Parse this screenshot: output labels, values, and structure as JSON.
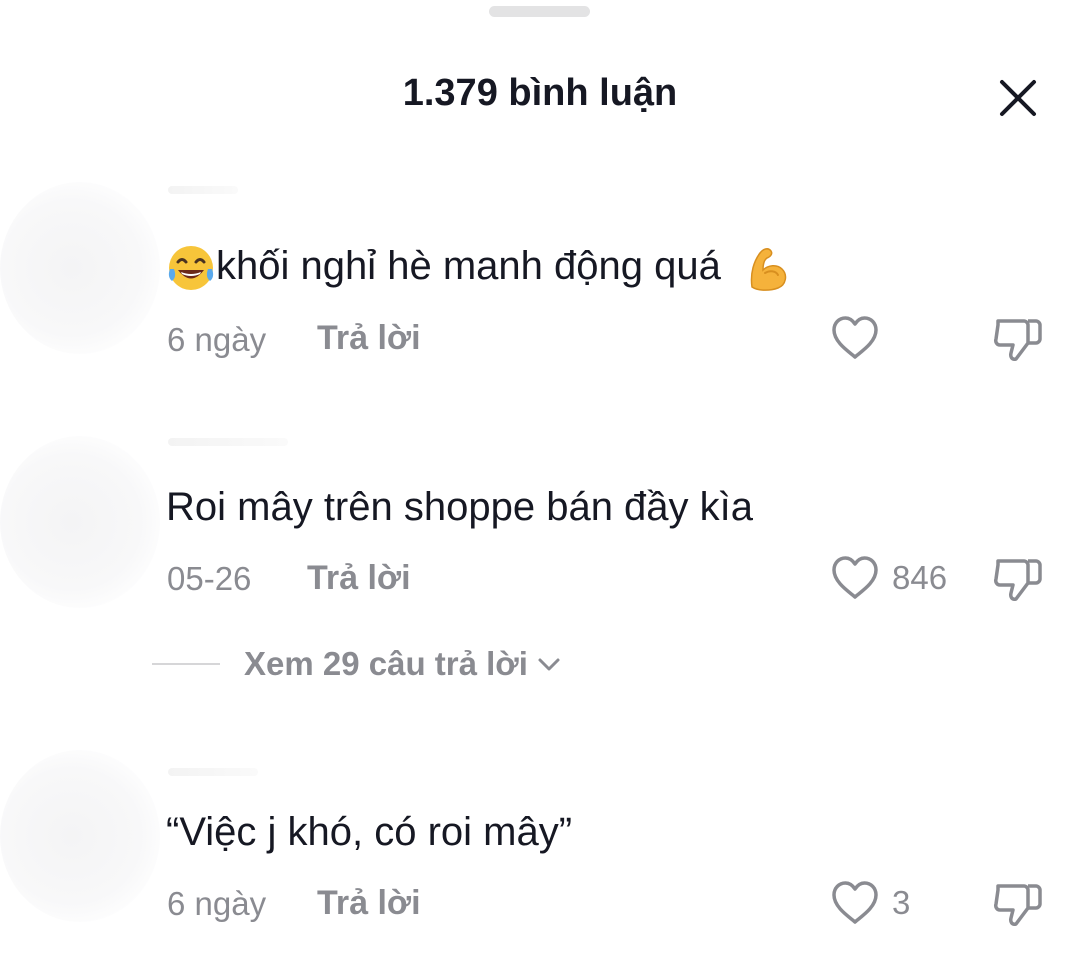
{
  "header": {
    "title": "1.379 bình luận"
  },
  "comments": [
    {
      "text": "khối nghỉ hè manh động quá",
      "emoji_before": "face-with-tears-of-joy",
      "emoji_after": "flexed-biceps",
      "time": "6 ngày",
      "reply_label": "Trả lời",
      "like_count": ""
    },
    {
      "text": "Roi mây trên shoppe bán đầy kìa",
      "time": "05-26",
      "reply_label": "Trả lời",
      "like_count": "846",
      "view_replies": "Xem 29 câu trả lời"
    },
    {
      "text": "“Việc j khó, có roi mây”",
      "time": "6 ngày",
      "reply_label": "Trả lời",
      "like_count": "3"
    }
  ],
  "icons": {
    "close": "close-icon",
    "like": "heart-outline-icon",
    "dislike": "thumbs-down-icon",
    "expand": "chevron-down-icon"
  },
  "colors": {
    "text_primary": "#161823",
    "text_secondary": "#8a8b91"
  }
}
